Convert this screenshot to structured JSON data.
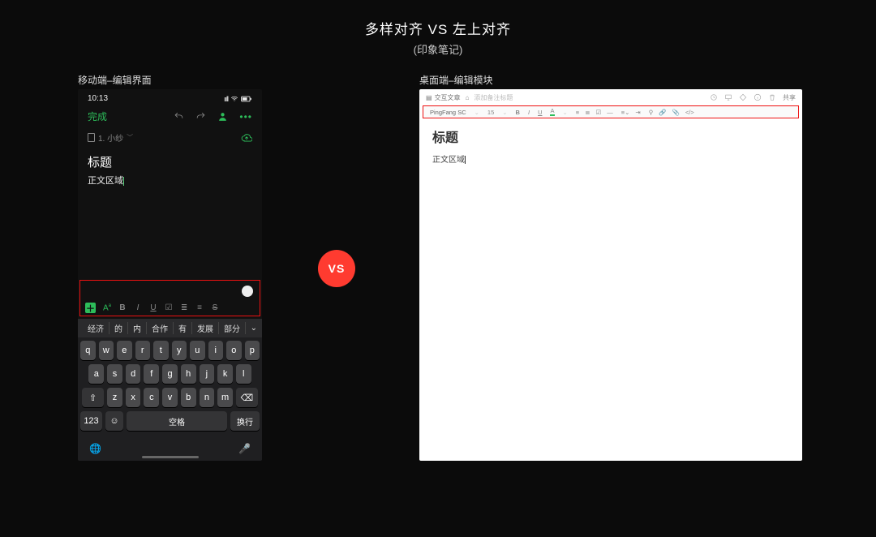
{
  "header": {
    "title": "多样对齐 VS 左上对齐",
    "subtitle": "(印象笔记)"
  },
  "labels": {
    "mobile": "移动端–编辑界面",
    "desktop": "桌面端–编辑模块"
  },
  "vs": "VS",
  "mobile": {
    "status": {
      "time": "10:13"
    },
    "done": "完成",
    "notebook": "1. 小纱",
    "title": "标题",
    "body": "正文区域",
    "toolbar": {
      "aa": "A",
      "aa_sup": "a",
      "bold": "B",
      "italic": "I",
      "underline": "U",
      "check": "☑",
      "list_ol": "≣",
      "list_ul": "≡",
      "strike": "S"
    },
    "suggestions": [
      "经济",
      "的",
      "内",
      "合作",
      "有",
      "发展",
      "部分"
    ],
    "keyboard": {
      "row1": [
        "q",
        "w",
        "e",
        "r",
        "t",
        "y",
        "u",
        "i",
        "o",
        "p"
      ],
      "row2": [
        "a",
        "s",
        "d",
        "f",
        "g",
        "h",
        "j",
        "k",
        "l"
      ],
      "row3_shift": "⇧",
      "row3": [
        "z",
        "x",
        "c",
        "v",
        "b",
        "n",
        "m"
      ],
      "row3_del": "⌫",
      "k123": "123",
      "emoji": "☺",
      "space": "空格",
      "ret": "换行"
    }
  },
  "desktop": {
    "crumb_icon_label": "交互文章",
    "home_icon": "⌂",
    "placeholder": "添加备注标题",
    "share": "共享",
    "toolbar": {
      "font": "PingFang SC",
      "size": "15",
      "bold": "B",
      "italic": "I",
      "underline": "U",
      "color": "A"
    },
    "title": "标题",
    "body": "正文区域"
  }
}
